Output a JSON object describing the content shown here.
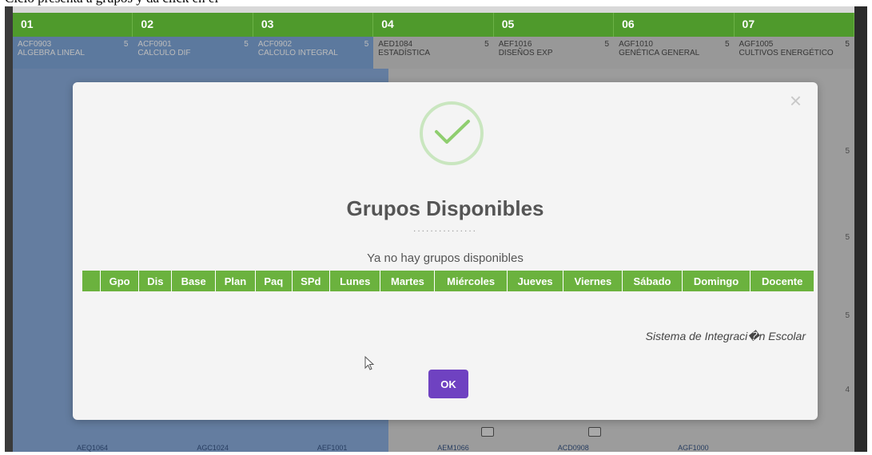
{
  "caption_strip": "Ciclo presenta a grupos y da click en el",
  "background_table": {
    "headers": [
      "01",
      "02",
      "03",
      "04",
      "05",
      "06",
      "07"
    ],
    "row1": [
      {
        "code": "ACF0903",
        "name": "ALGEBRA LINEAL",
        "credits": "5"
      },
      {
        "code": "ACF0901",
        "name": "CALCULO DIF",
        "credits": "5"
      },
      {
        "code": "ACF0902",
        "name": "CALCULO INTEGRAL",
        "credits": "5"
      },
      {
        "code": "AED1084",
        "name": "ESTADÍSTICA",
        "credits": "5"
      },
      {
        "code": "AEF1016",
        "name": "DISEÑOS EXP",
        "credits": "5"
      },
      {
        "code": "AGF1010",
        "name": "GENÉTICA GENERAL",
        "credits": "5"
      },
      {
        "code": "AGF1005",
        "name": "CULTIVOS ENERGÉTICO",
        "credits": "5"
      }
    ],
    "bottom_row": [
      "AEQ1064",
      "AGC1024",
      "AEF1001",
      "AEM1066",
      "ACD0908",
      "AGF1000",
      ""
    ],
    "side_numbers": [
      "5",
      "5",
      "5",
      "4"
    ]
  },
  "modal": {
    "close_symbol": "×",
    "title": "Grupos Disponibles",
    "dots": "...............",
    "message": "Ya no hay grupos disponibles",
    "columns": [
      "",
      "Gpo",
      "Dis",
      "Base",
      "Plan",
      "Paq",
      "SPd",
      "Lunes",
      "Martes",
      "Miércoles",
      "Jueves",
      "Viernes",
      "Sábado",
      "Domingo",
      "Docente"
    ],
    "footer_note": "Sistema de Integraci�n Escolar",
    "ok_label": "OK"
  },
  "colors": {
    "header_green": "#4f9a2c",
    "grid_green": "#6bb23e",
    "ok_purple": "#6f42c1",
    "check_green": "#8fce6f"
  },
  "icons": [
    "check-icon",
    "close-icon",
    "mouse-cursor-icon",
    "document-icon"
  ]
}
